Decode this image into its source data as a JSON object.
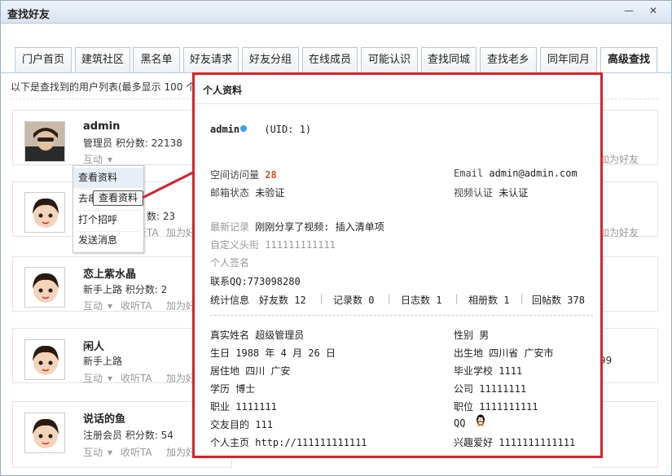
{
  "window": {
    "title": "查找好友",
    "minimize": "—",
    "close": "✕"
  },
  "tabs": [
    {
      "label": "门户首页"
    },
    {
      "label": "建筑社区"
    },
    {
      "label": "黑名单"
    },
    {
      "label": "好友请求"
    },
    {
      "label": "好友分组"
    },
    {
      "label": "在线成员"
    },
    {
      "label": "可能认识"
    },
    {
      "label": "查找同城"
    },
    {
      "label": "查找老乡"
    },
    {
      "label": "同年同月"
    },
    {
      "label": "高级查找"
    }
  ],
  "active_tab": "高级查找",
  "list_info": "以下是查找到的用户列表(最多显示 100 个",
  "users": [
    {
      "name": "admin",
      "meta": "管理员  积分数: 22138",
      "action": "互动",
      "avatar": "photo"
    },
    {
      "name": "",
      "meta": "数: 23",
      "action": "互动",
      "avatar": "cartoon",
      "follow": "收听TA",
      "add": "加为好"
    },
    {
      "name": "恋上紫水晶",
      "meta": "新手上路  积分数: 2",
      "action": "互动",
      "follow": "收听TA",
      "add": "加为好",
      "avatar": "cartoon"
    },
    {
      "name": "闲人",
      "meta": "新手上路",
      "action": "互动",
      "follow": "收听TA",
      "add": "加为好",
      "avatar": "cartoon"
    },
    {
      "name": "说话的鱼",
      "meta": "注册会员  积分数: 54",
      "action": "互动",
      "follow": "收听TA",
      "add": "加为好",
      "avatar": "cartoon"
    }
  ],
  "right_column": [
    "加为好友",
    "",
    "加为好友",
    "99",
    ""
  ],
  "dropdown": {
    "items": [
      "查看资料",
      "去串",
      "打个招呼",
      "发送消息"
    ]
  },
  "tooltip": "查看资料",
  "profile": {
    "header": "个人资料",
    "username": "admin",
    "uid": "(UID: 1)",
    "visits_label": "空间访问量",
    "visits": "28",
    "email_label": "Email",
    "email": "admin@admin.com",
    "mail_status_label": "邮箱状态",
    "mail_status": "未验证",
    "video_label": "视频认证",
    "video": "未认证",
    "latest_label": "最新记录",
    "latest": "刚刚分享了视频: 插入清单项",
    "custom_title_label": "自定义头衔",
    "custom_title": "111111111111",
    "signature_label": "个人签名",
    "qq_contact_label": "联系QQ:",
    "qq_contact": "773098280",
    "stats_label": "统计信息",
    "stats": [
      {
        "label": "好友数",
        "value": "12"
      },
      {
        "label": "记录数",
        "value": "0"
      },
      {
        "label": "日志数",
        "value": "1"
      },
      {
        "label": "相册数",
        "value": "1"
      },
      {
        "label": "回帖数",
        "value": "378"
      }
    ],
    "realname_label": "真实姓名",
    "realname": "超级管理员",
    "gender_label": "性别",
    "gender": "男",
    "birthday_label": "生日",
    "birthday": "1988 年 4 月 26 日",
    "birthplace_label": "出生地",
    "birthplace": "四川省 广安市",
    "residence_label": "居住地",
    "residence": "四川 广安",
    "school_label": "毕业学校",
    "school": "1111",
    "degree_label": "学历",
    "degree": "博士",
    "company_label": "公司",
    "company": "11111111",
    "job_label": "职业",
    "job": "1111111",
    "position_label": "职位",
    "position": "1111111111",
    "purpose_label": "交友目的",
    "purpose": "111",
    "qq_label": "QQ",
    "homepage_label": "个人主页",
    "homepage": "http://111111111111",
    "hobby_label": "兴趣爱好",
    "hobby": "1111111111111"
  },
  "colors": {
    "accent_red": "#d8232a",
    "visits_orange": "#d9531e",
    "online_blue": "#3aa0e8"
  },
  "icons": [
    "chevron-down-icon",
    "online-status-icon",
    "qq-penguin-icon",
    "minimize-icon",
    "close-icon"
  ]
}
